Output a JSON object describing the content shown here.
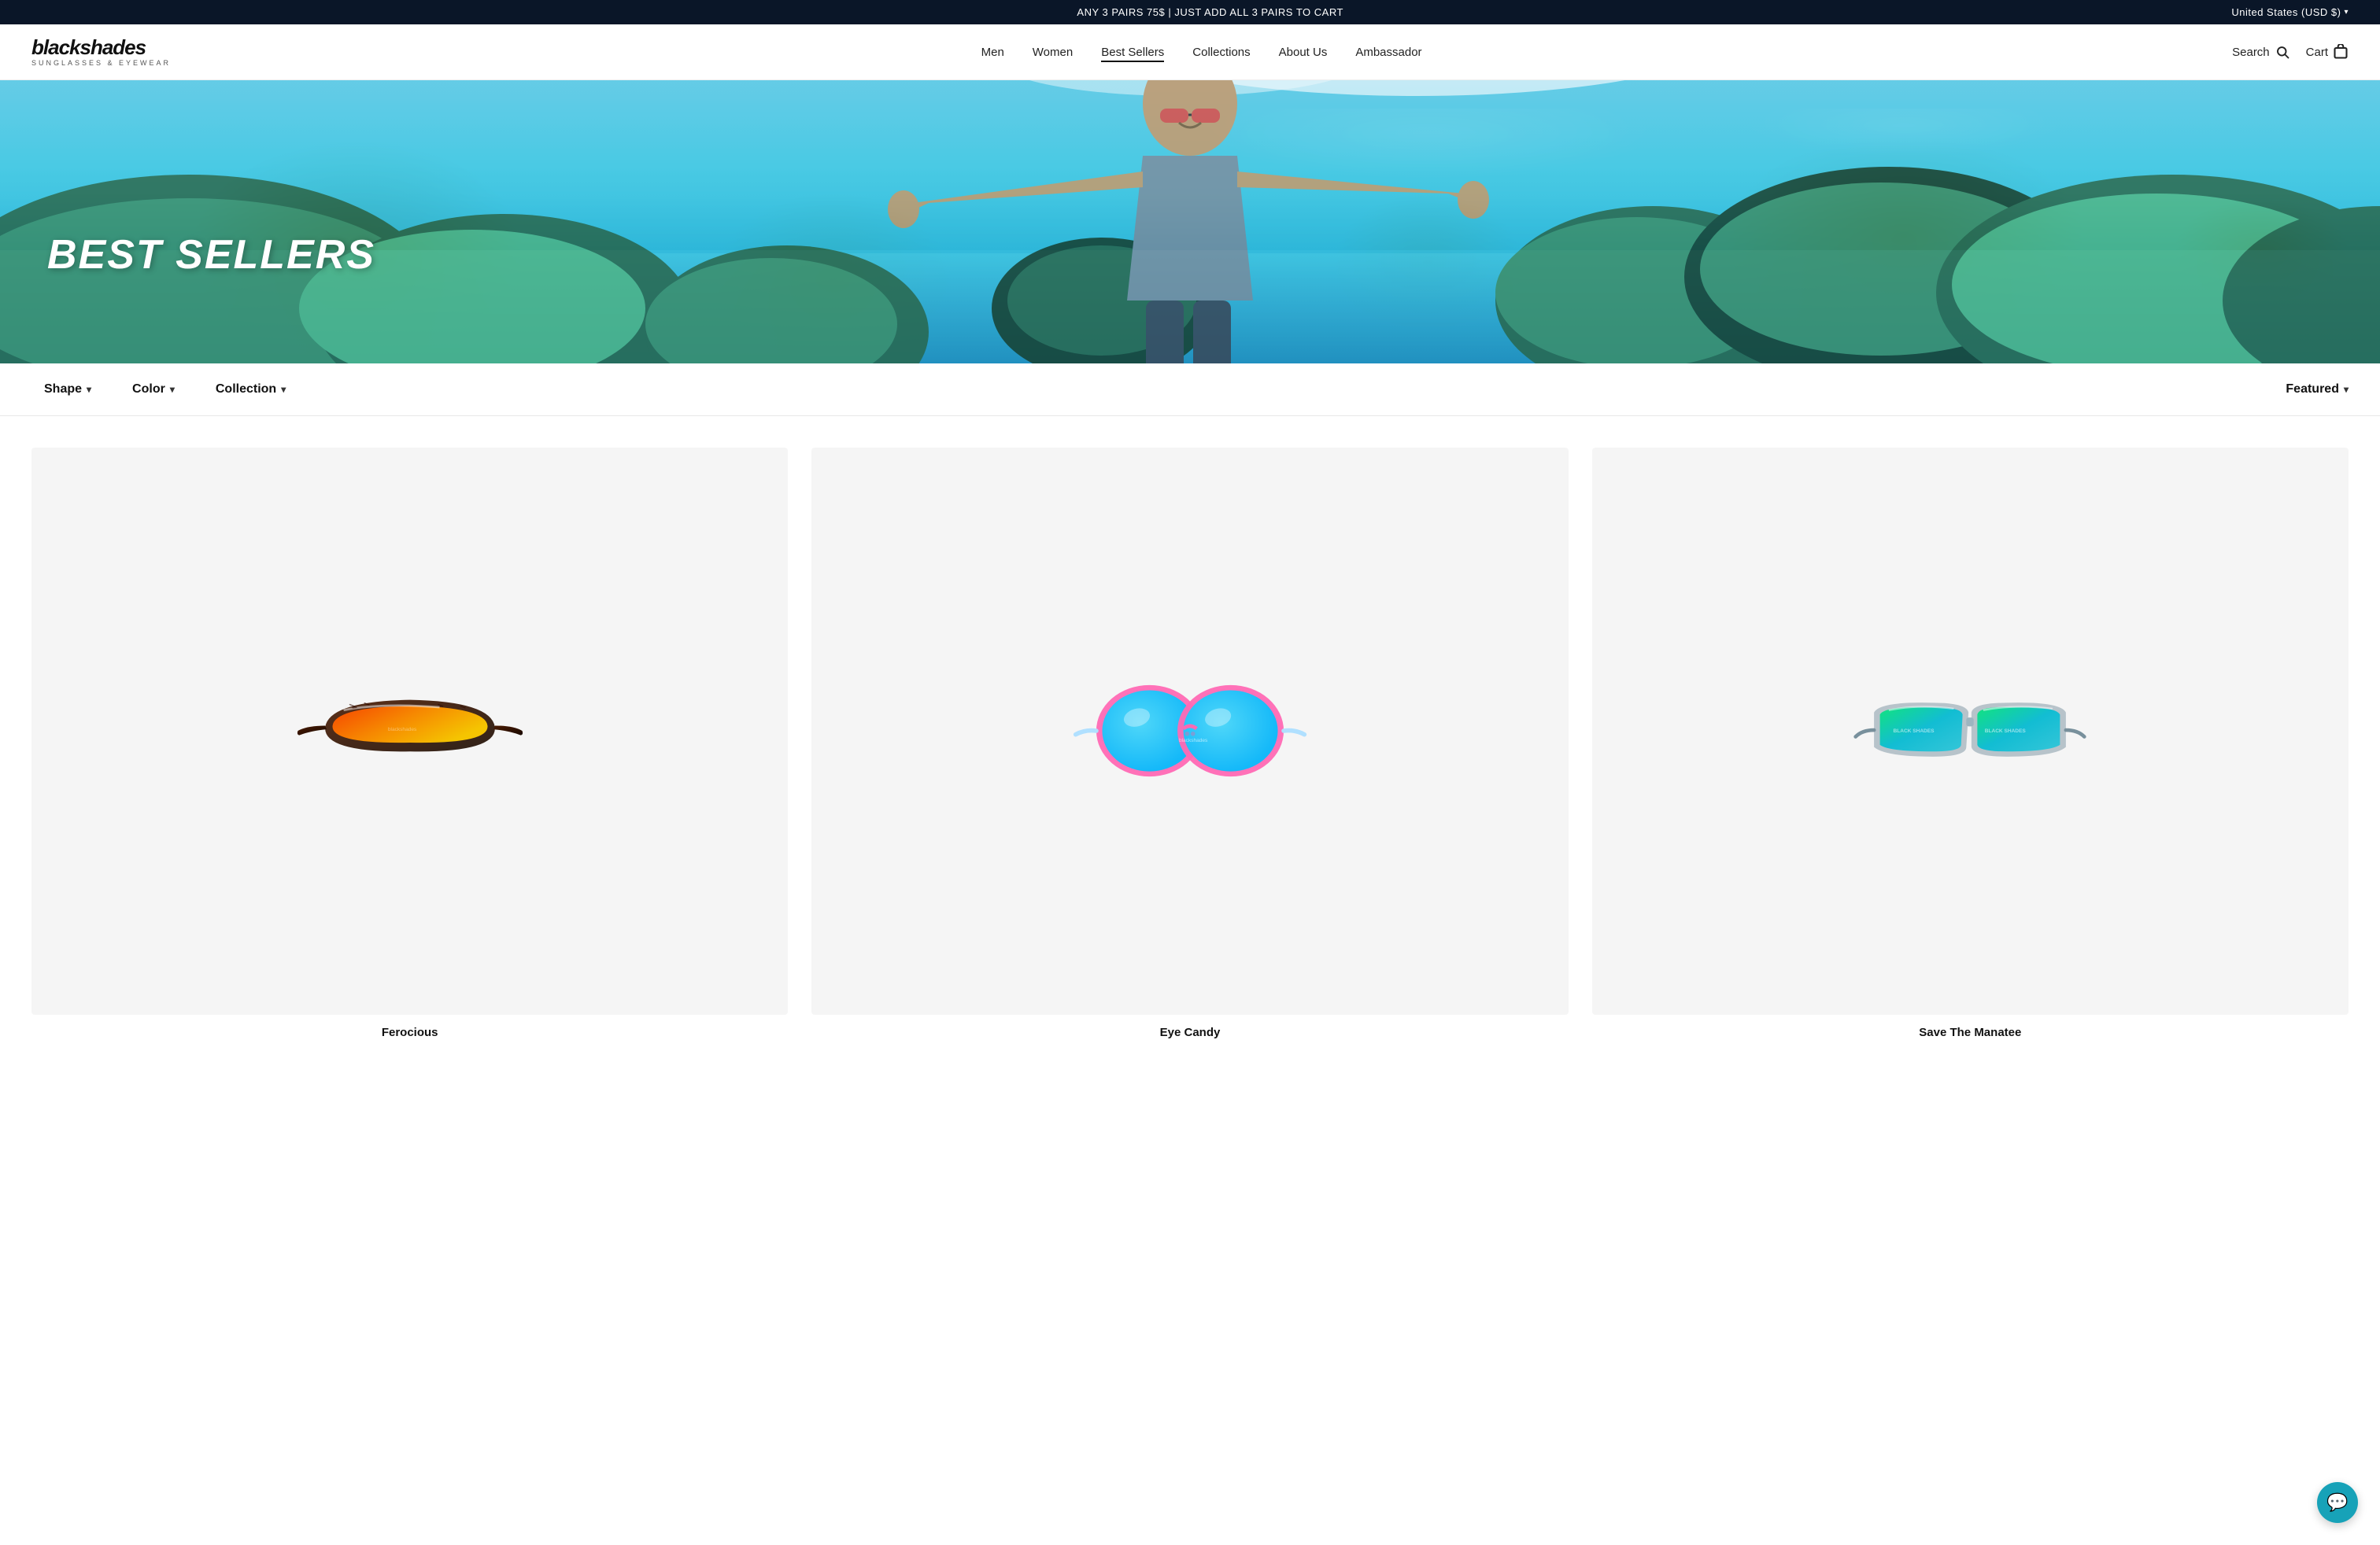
{
  "announcement": {
    "text": "ANY 3 PAIRS 75$ | JUST ADD ALL 3 PAIRS TO CART",
    "region": "United States (USD $)"
  },
  "header": {
    "logo": {
      "name": "blackshades",
      "tagline": "SUNGLASSES & EYEWEAR"
    },
    "nav": [
      {
        "label": "Men",
        "active": false
      },
      {
        "label": "Women",
        "active": false
      },
      {
        "label": "Best Sellers",
        "active": true
      },
      {
        "label": "Collections",
        "active": false
      },
      {
        "label": "About Us",
        "active": false
      },
      {
        "label": "Ambassador",
        "active": false
      }
    ],
    "search_label": "Search",
    "cart_label": "Cart"
  },
  "hero": {
    "title": "BEST SELLERS"
  },
  "filters": {
    "shape_label": "Shape",
    "color_label": "Color",
    "collection_label": "Collection",
    "sort_label": "Featured"
  },
  "products": [
    {
      "name": "Ferocious",
      "color_primary": "#ff4500",
      "color_secondary": "#ff8c00",
      "frame_color": "#3d1a0a",
      "type": "shield"
    },
    {
      "name": "Eye Candy",
      "color_primary": "#00bfff",
      "color_secondary": "#ff69b4",
      "frame_color": "#ff69b4",
      "type": "round"
    },
    {
      "name": "Save The Manatee",
      "color_primary": "#00e676",
      "color_secondary": "#00acc1",
      "frame_color": "#b0bec5",
      "type": "wayfarer"
    }
  ]
}
